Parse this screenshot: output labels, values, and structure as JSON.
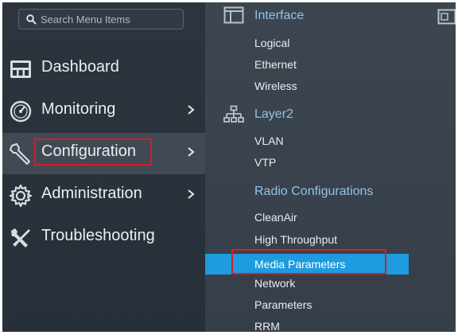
{
  "search": {
    "placeholder": "Search Menu Items",
    "icon": "search-icon"
  },
  "nav": [
    {
      "label": "Dashboard",
      "icon": "dashboard-icon",
      "has_submenu": false
    },
    {
      "label": "Monitoring",
      "icon": "gauge-icon",
      "has_submenu": true
    },
    {
      "label": "Configuration",
      "icon": "wrench-icon",
      "has_submenu": true,
      "active": true,
      "highlighted": true
    },
    {
      "label": "Administration",
      "icon": "gear-icon",
      "has_submenu": true
    },
    {
      "label": "Troubleshooting",
      "icon": "tools-icon",
      "has_submenu": false
    }
  ],
  "submenu": {
    "interface": {
      "title": "Interface",
      "icon": "window-icon",
      "items": [
        "Logical",
        "Ethernet",
        "Wireless"
      ]
    },
    "layer2": {
      "title": "Layer2",
      "icon": "network-tree-icon",
      "items": [
        "VLAN",
        "VTP"
      ]
    },
    "radio": {
      "title": "Radio Configurations",
      "items": [
        "CleanAir",
        "High Throughput",
        "Media Parameters",
        "Network",
        "Parameters",
        "RRM"
      ],
      "selected": "Media Parameters"
    }
  },
  "colors": {
    "highlight_box": "#d11f2a",
    "selected_bg": "#1d9ce0",
    "section_title": "#8fc4ea",
    "sidebar_bg": "#2c343e",
    "submenu_bg": "#3d4650"
  }
}
